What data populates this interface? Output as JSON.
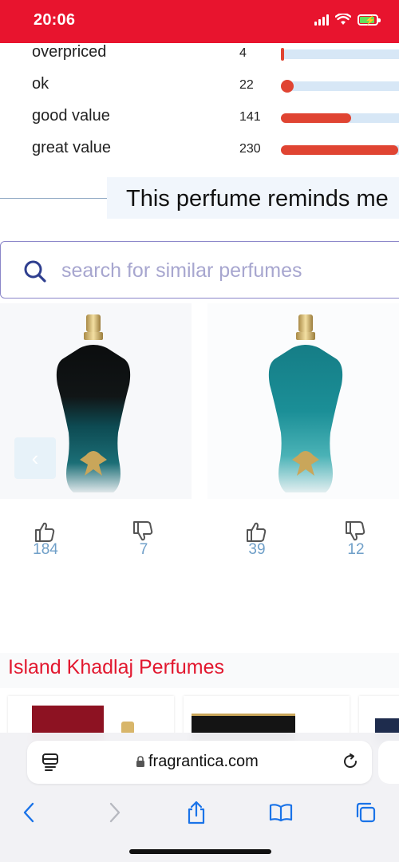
{
  "status_bar": {
    "time": "20:06",
    "bar_color": "#e8142e",
    "icons": [
      "signal-icon",
      "wifi-icon",
      "battery-charging-icon"
    ]
  },
  "value_ratings": [
    {
      "label": "overpriced",
      "count": "4",
      "fraction": 0.02
    },
    {
      "label": "ok",
      "count": "22",
      "fraction": 0.09
    },
    {
      "label": "good value",
      "count": "141",
      "fraction": 0.6
    },
    {
      "label": "great value",
      "count": "230",
      "fraction": 1.0
    }
  ],
  "reminds_me": {
    "heading": "This perfume reminds me"
  },
  "search": {
    "placeholder": "search for similar perfumes",
    "icon": "search-icon"
  },
  "similar_perfumes": [
    {
      "bottle_icon": "perfume-bottle-dark-teal-icon",
      "likes": "184",
      "dislikes": "7"
    },
    {
      "bottle_icon": "perfume-bottle-teal-icon",
      "likes": "39",
      "dislikes": "12"
    }
  ],
  "section": {
    "title": "Island Khadlaj Perfumes",
    "title_color": "#e2182f"
  },
  "browser": {
    "url": "fragrantica.com",
    "toolbar_icons": [
      "back-icon",
      "forward-icon",
      "share-icon",
      "bookmarks-icon",
      "tabs-icon"
    ],
    "accent": "#1a73e8"
  }
}
